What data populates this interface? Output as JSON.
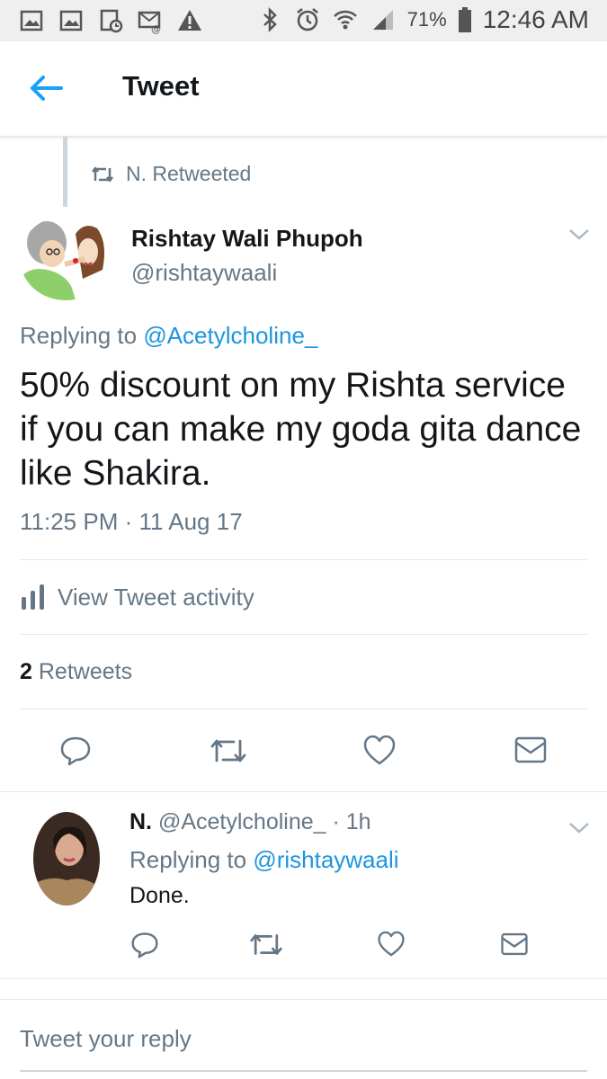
{
  "status_bar": {
    "battery": "71%",
    "time": "12:46 AM"
  },
  "header": {
    "title": "Tweet"
  },
  "retweet_context": "N. Retweeted",
  "tweet": {
    "author_name": "Rishtay Wali Phupoh",
    "author_handle": "@rishtaywaali",
    "replying_prefix": "Replying to",
    "replying_to": "@Acetylcholine_",
    "text": "50% discount on my Rishta service if you can make my goda gita dance like Shakira.",
    "timestamp": "11:25 PM · 11 Aug 17",
    "activity_label": "View Tweet activity",
    "retweet_count": "2",
    "retweet_label": "Retweets"
  },
  "reply": {
    "name": "N.",
    "handle_time": "@Acetylcholine_ · 1h",
    "replying_prefix": "Replying to",
    "replying_to": "@rishtaywaali",
    "text": "Done."
  },
  "compose": {
    "placeholder": "Tweet your reply"
  },
  "colors": {
    "accent": "#1da1f2",
    "secondary_text": "#657786",
    "primary_text": "#14171a"
  }
}
